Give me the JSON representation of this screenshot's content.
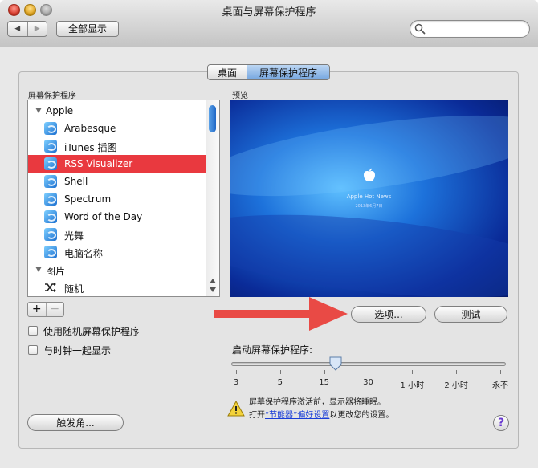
{
  "window": {
    "title": "桌面与屏幕保护程序"
  },
  "toolbar": {
    "back_icon": "◀",
    "forward_icon": "▶",
    "show_all_label": "全部显示",
    "search_placeholder": ""
  },
  "tabs": [
    {
      "label": "桌面",
      "selected": false
    },
    {
      "label": "屏幕保护程序",
      "selected": true
    }
  ],
  "screensavers": {
    "label": "屏幕保护程序",
    "groups": [
      {
        "label": "Apple",
        "items": [
          "Arabesque",
          "iTunes 插图",
          "RSS Visualizer",
          "Shell",
          "Spectrum",
          "Word of the Day",
          "光舞",
          "电脑名称"
        ]
      },
      {
        "label": "图片",
        "items": [
          "随机"
        ]
      }
    ],
    "selected": "RSS Visualizer",
    "add_label": "+",
    "remove_label": "−"
  },
  "options": {
    "random_label": "使用随机屏幕保护程序",
    "show_clock_label": "与时钟一起显示",
    "hot_corners_label": "触发角..."
  },
  "preview": {
    "label": "预览",
    "title_text": "Apple Hot News",
    "sub_text": "2013年6月7日",
    "options_button": "选项...",
    "test_button": "测试"
  },
  "start": {
    "label": "启动屏幕保护程序:",
    "ticks": [
      "3",
      "5",
      "15",
      "30",
      "1 小时",
      "2 小时",
      "永不"
    ],
    "value": "15"
  },
  "warning": {
    "line1": "屏幕保护程序激活前，显示器将睡眠。",
    "line2_prefix": "打开",
    "line2_link": "“节能器”偏好设置",
    "line2_suffix": "以更改您的设置。"
  },
  "colors": {
    "selection": "#e9393f",
    "accent": "#2a6fd6",
    "arrow": "#e94a45"
  }
}
